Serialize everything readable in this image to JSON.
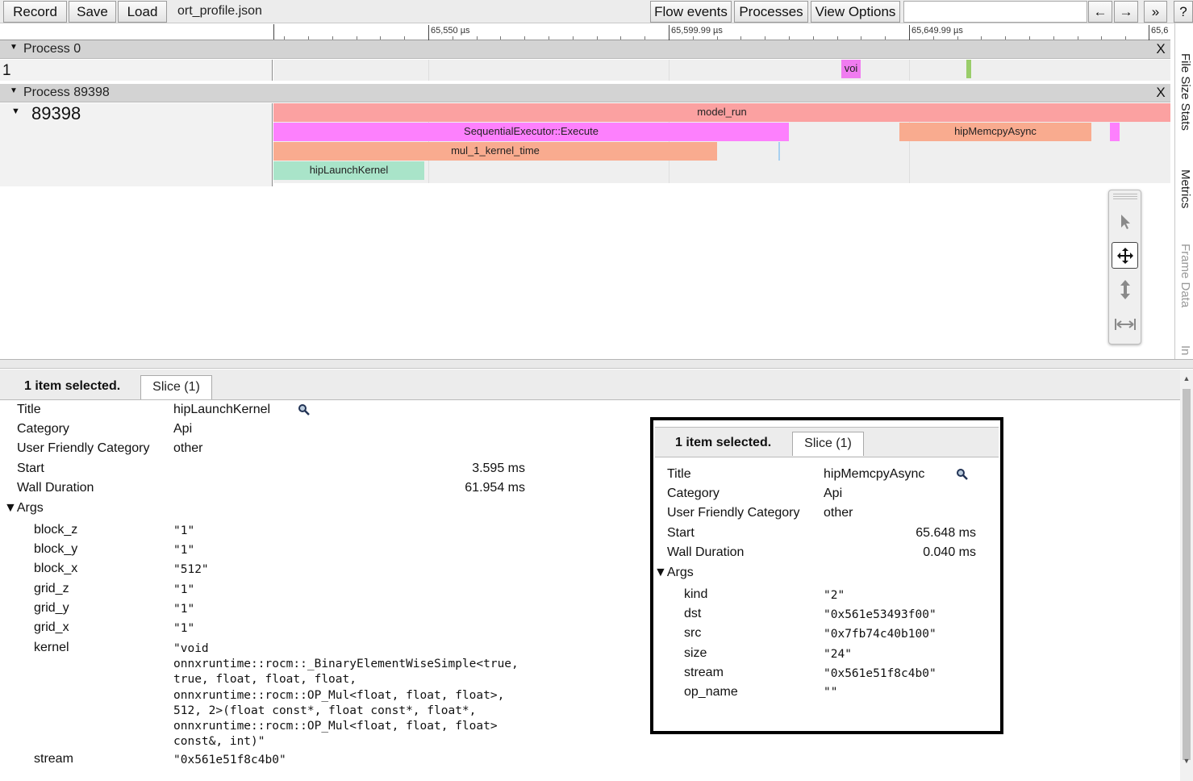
{
  "toolbar": {
    "record": "Record",
    "save": "Save",
    "load": "Load",
    "filename": "ort_profile.json",
    "flow_events": "Flow events",
    "processes": "Processes",
    "view_options": "View Options",
    "search_value": "",
    "prev": "←",
    "next": "→",
    "more": "»",
    "help": "?"
  },
  "ruler": {
    "ticks": [
      "65,550 µs",
      "65,599.99 µs",
      "65,649.99 µs",
      "65,6"
    ]
  },
  "processes": [
    {
      "name": "Process 0",
      "close": "X",
      "thread_label": "1",
      "slices": [
        {
          "name": "voi",
          "color": "#f07cf0"
        },
        {
          "name": "",
          "color": "#9acd6a"
        }
      ]
    },
    {
      "name": "Process 89398",
      "close": "X",
      "thread_label": "89398",
      "slices": [
        {
          "name": "model_run",
          "color": "#fba1a1"
        },
        {
          "name": "SequentialExecutor::Execute",
          "color": "#fd80fd"
        },
        {
          "name": "hipMemcpyAsync",
          "color": "#f9ab8f"
        },
        {
          "name": "",
          "color": "#fd80fd"
        },
        {
          "name": "mul_1_kernel_time",
          "color": "#f9ab8f"
        },
        {
          "name": "hipLaunchKernel",
          "color": "#a9e4c9"
        }
      ]
    }
  ],
  "mouse_modes": [
    "selection-tool",
    "pan-tool",
    "zoom-tool",
    "timing-tool"
  ],
  "side_tabs": [
    "File Size Stats",
    "Metrics",
    "Frame Data",
    "In"
  ],
  "analysis": {
    "selected_count": "1 item selected.",
    "tab": "Slice (1)",
    "title_label": "Title",
    "title_value": "hipLaunchKernel",
    "category_label": "Category",
    "category_value": "Api",
    "ufc_label": "User Friendly Category",
    "ufc_value": "other",
    "start_label": "Start",
    "start_value": "3.595 ms",
    "wall_label": "Wall Duration",
    "wall_value": "61.954 ms",
    "args_label": "▼Args",
    "args": [
      {
        "key": "block_z",
        "value": "\"1\""
      },
      {
        "key": "block_y",
        "value": "\"1\""
      },
      {
        "key": "block_x",
        "value": "\"512\""
      },
      {
        "key": "grid_z",
        "value": "\"1\""
      },
      {
        "key": "grid_y",
        "value": "\"1\""
      },
      {
        "key": "grid_x",
        "value": "\"1\""
      },
      {
        "key": "kernel",
        "value": "\"void\nonnxruntime::rocm::_BinaryElementWiseSimple<true,\ntrue, float, float, float,\nonnxruntime::rocm::OP_Mul<float, float, float>,\n512, 2>(float const*, float const*, float*,\nonnxruntime::rocm::OP_Mul<float, float, float>\nconst&, int)\""
      },
      {
        "key": "stream",
        "value": "\"0x561e51f8c4b0\""
      }
    ]
  },
  "popup": {
    "selected_count": "1 item selected.",
    "tab": "Slice (1)",
    "title_label": "Title",
    "title_value": "hipMemcpyAsync",
    "category_label": "Category",
    "category_value": "Api",
    "ufc_label": "User Friendly Category",
    "ufc_value": "other",
    "start_label": "Start",
    "start_value": "65.648 ms",
    "wall_label": "Wall Duration",
    "wall_value": "0.040 ms",
    "args_label": "▼Args",
    "args": [
      {
        "key": "kind",
        "value": "\"2\""
      },
      {
        "key": "dst",
        "value": "\"0x561e53493f00\""
      },
      {
        "key": "src",
        "value": "\"0x7fb74c40b100\""
      },
      {
        "key": "size",
        "value": "\"24\""
      },
      {
        "key": "stream",
        "value": "\"0x561e51f8c4b0\""
      },
      {
        "key": "op_name",
        "value": "\"\""
      }
    ]
  }
}
